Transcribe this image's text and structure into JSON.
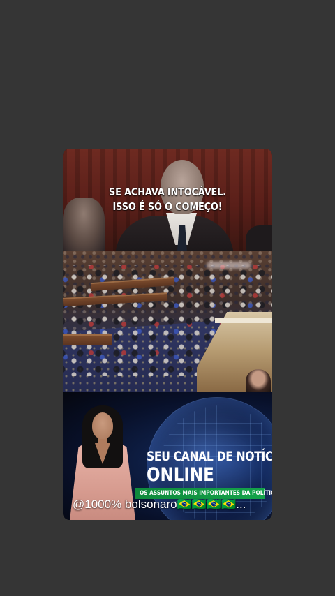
{
  "story": {
    "caption_line1": "SE ACHAVA INTOCÁVEL.",
    "caption_line2": "ISSO É SÓ  O COMEÇO!",
    "promo": {
      "headline_line1": "SEU CANAL DE NOTÍCIA",
      "headline_line2": "ONLINE",
      "subtitle": "OS ASSUNTOS MAIS IMPORTANTES DA POLÍTICA",
      "accent_color": "#14a34a"
    },
    "handle": "@1000% bolsonaro🇧🇷🇧🇷🇧🇷🇧🇷..."
  },
  "colors": {
    "background": "#353535",
    "text": "#ffffff"
  }
}
